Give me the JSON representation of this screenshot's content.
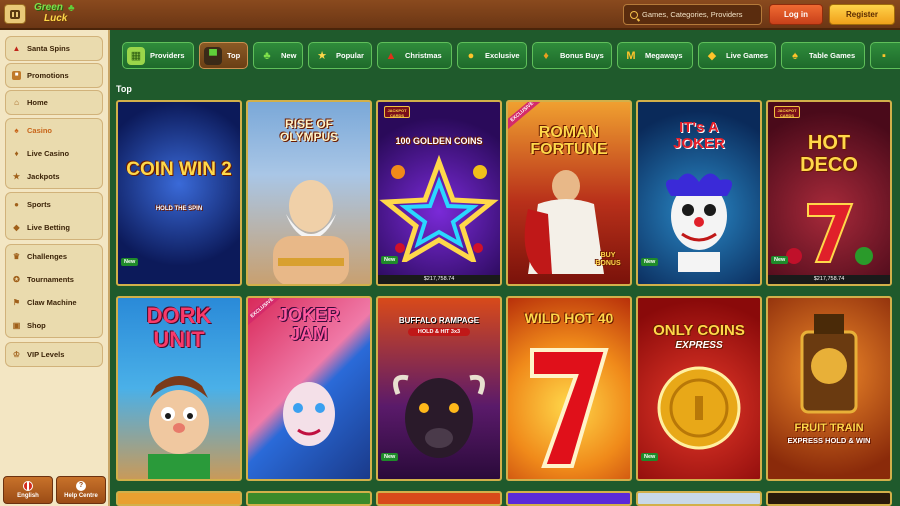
{
  "header": {
    "logo_line1": "Green",
    "logo_line2": "Luck",
    "search_placeholder": "Games, Categories, Providers",
    "login_label": "Log in",
    "register_label": "Register"
  },
  "sidebar": {
    "groups": [
      {
        "items": [
          {
            "label": "Santa Spins",
            "icon": "santa-hat-icon"
          }
        ]
      },
      {
        "items": [
          {
            "label": "Promotions",
            "icon": "gift-icon"
          }
        ]
      },
      {
        "items": [
          {
            "label": "Home",
            "icon": "home-icon"
          }
        ]
      },
      {
        "items": [
          {
            "label": "Casino",
            "icon": "cards-icon",
            "active": true
          },
          {
            "label": "Live Casino",
            "icon": "live-icon"
          },
          {
            "label": "Jackpots",
            "icon": "jackpot-icon"
          }
        ]
      },
      {
        "items": [
          {
            "label": "Sports",
            "icon": "ball-icon"
          },
          {
            "label": "Live Betting",
            "icon": "live-betting-icon"
          }
        ]
      },
      {
        "items": [
          {
            "label": "Challenges",
            "icon": "trophy-icon"
          },
          {
            "label": "Tournaments",
            "icon": "medal-icon"
          },
          {
            "label": "Claw Machine",
            "icon": "claw-icon"
          },
          {
            "label": "Shop",
            "icon": "shop-icon"
          }
        ]
      },
      {
        "items": [
          {
            "label": "VIP Levels",
            "icon": "crown-icon"
          }
        ]
      }
    ],
    "language_label": "English",
    "help_label": "Help Centre"
  },
  "tabs": [
    {
      "label": "Providers",
      "icon": "providers-icon"
    },
    {
      "label": "Top",
      "icon": "top-hat-icon",
      "active": true
    },
    {
      "label": "New",
      "icon": "clover-icon"
    },
    {
      "label": "Popular",
      "icon": "star-icon"
    },
    {
      "label": "Christmas",
      "icon": "christmas-hat-icon"
    },
    {
      "label": "Exclusive",
      "icon": "coin-icon"
    },
    {
      "label": "Bonus Buys",
      "icon": "bonus-bag-icon"
    },
    {
      "label": "Megaways",
      "icon": "megaways-icon"
    },
    {
      "label": "Live Games",
      "icon": "live-games-icon"
    },
    {
      "label": "Table Games",
      "icon": "table-games-icon"
    }
  ],
  "section_title": "Top",
  "games_row1": [
    {
      "title": "COIN WIN 2",
      "subtitle": "HOLD THE SPIN",
      "badge": "New"
    },
    {
      "title": "RISE OF OLYMPUS",
      "subtitle": "",
      "badge": ""
    },
    {
      "title": "100 GOLDEN COINS",
      "subtitle": "",
      "badge": "New",
      "jackpot": "$217,758.74",
      "jackpot_logo": "JACKPOT CARDS"
    },
    {
      "title": "ROMAN FORTUNE",
      "subtitle": "BUY BONUS",
      "badge": "",
      "exclusive": "EXCLUSIVE"
    },
    {
      "title": "IT's A JOKER",
      "subtitle": "",
      "badge": "New"
    },
    {
      "title": "HOT DECO",
      "subtitle": "",
      "badge": "New",
      "jackpot": "$217,758.74",
      "jackpot_logo": "JACKPOT CARDS"
    }
  ],
  "games_row2": [
    {
      "title": "DORK UNIT",
      "subtitle": "",
      "badge": ""
    },
    {
      "title": "JOKER JAM",
      "subtitle": "",
      "badge": "",
      "exclusive": "EXCLUSIVE"
    },
    {
      "title": "BUFFALO RAMPAGE",
      "subtitle": "HOLD & HIT 3x3",
      "badge": "New"
    },
    {
      "title": "WILD HOT 40",
      "subtitle": "",
      "badge": ""
    },
    {
      "title": "ONLY COINS",
      "subtitle": "EXPRESS",
      "badge": "New"
    },
    {
      "title": "FRUIT TRAIN",
      "subtitle": "EXPRESS HOLD & WIN",
      "badge": ""
    }
  ]
}
